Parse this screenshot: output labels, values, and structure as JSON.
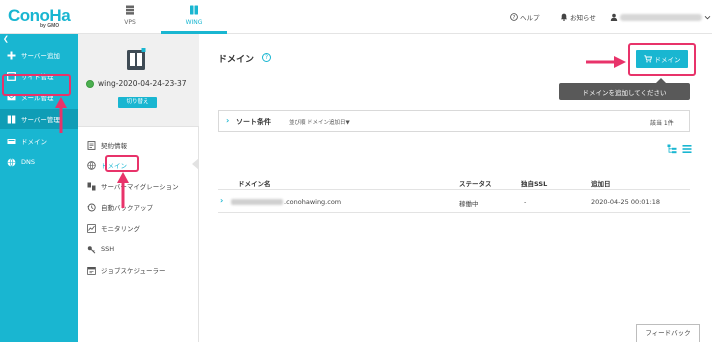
{
  "brand": {
    "logo": "ConoHa",
    "logo_sub": "by GMO",
    "accent": "#19b6d1",
    "highlight": "#e8336a"
  },
  "topbar": {
    "tabs": [
      {
        "label": "VPS",
        "icon": "server-stack-icon"
      },
      {
        "label": "WING",
        "icon": "wing-server-icon"
      }
    ],
    "help_label": "ヘルプ",
    "notice_label": "お知らせ"
  },
  "leftnav": {
    "collapse_icon": "chevron-left-icon",
    "items": [
      {
        "label": "サーバー追加",
        "icon": "plus-icon"
      },
      {
        "label": "サイト管理",
        "icon": "site-icon"
      },
      {
        "label": "メール管理",
        "icon": "mail-icon"
      },
      {
        "label": "サーバー管理",
        "icon": "server-icon"
      },
      {
        "label": "ドメイン",
        "icon": "domain-icon"
      },
      {
        "label": "DNS",
        "icon": "globe-icon"
      }
    ]
  },
  "server": {
    "name": "wing-2020-04-24-23-37",
    "switch_label": "切り替え"
  },
  "subnav": {
    "items": [
      {
        "label": "契約情報",
        "icon": "contract-icon"
      },
      {
        "label": "ドメイン",
        "icon": "globe-icon"
      },
      {
        "label": "サーバーマイグレーション",
        "icon": "migration-icon"
      },
      {
        "label": "自動バックアップ",
        "icon": "backup-icon"
      },
      {
        "label": "モニタリング",
        "icon": "monitor-icon"
      },
      {
        "label": "SSH",
        "icon": "key-icon"
      },
      {
        "label": "ジョブスケジューラー",
        "icon": "scheduler-icon"
      }
    ]
  },
  "main": {
    "title": "ドメイン",
    "add_button_label": "ドメイン",
    "tooltip": "ドメインを追加してください",
    "sort": {
      "label": "ソート条件",
      "order_label": "並び順",
      "order_value": "ドメイン追加日▼",
      "count": "該当 1件"
    },
    "columns": [
      "ドメイン名",
      "ステータス",
      "独自SSL",
      "追加日"
    ],
    "rows": [
      {
        "domain": ".conohawing.com",
        "status": "稼働中",
        "ssl": "-",
        "date": "2020-04-25 00:01:18"
      }
    ],
    "feedback_label": "フィードバック"
  }
}
